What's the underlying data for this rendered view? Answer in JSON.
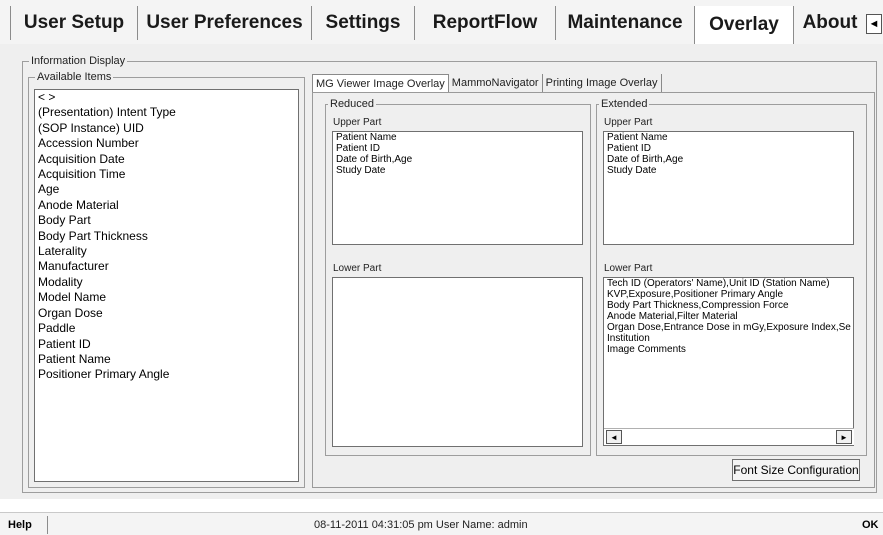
{
  "tabs": [
    "User Setup",
    "User Preferences",
    "Settings",
    "ReportFlow",
    "Maintenance",
    "Overlay",
    "About"
  ],
  "tab_scroll_icon": "◄",
  "info_display": {
    "legend": "Information Display",
    "available": {
      "legend": "Available Items",
      "items": [
        "< >",
        "(Presentation) Intent Type",
        "(SOP Instance) UID",
        "Accession Number",
        "Acquisition Date",
        "Acquisition Time",
        "Age",
        "Anode Material",
        "Body Part",
        "Body Part Thickness",
        "Laterality",
        "Manufacturer",
        "Modality",
        "Model Name",
        "Organ Dose",
        "Paddle",
        "Patient ID",
        "Patient Name",
        "Positioner Primary Angle"
      ]
    }
  },
  "subtabs": [
    "MG Viewer Image Overlay",
    "MammoNavigator",
    "Printing Image Overlay"
  ],
  "reduced": {
    "legend": "Reduced",
    "upper_label": "Upper Part",
    "upper_items": [
      "Patient Name",
      "Patient ID",
      "Date of Birth,Age",
      "Study Date"
    ],
    "lower_label": "Lower Part",
    "lower_items": []
  },
  "extended": {
    "legend": "Extended",
    "upper_label": "Upper Part",
    "upper_items": [
      "Patient Name",
      "Patient ID",
      "Date of Birth,Age",
      "Study Date"
    ],
    "lower_label": "Lower Part",
    "lower_items": [
      "Tech ID (Operators' Name),Unit ID (Station Name)",
      "KVP,Exposure,Positioner Primary Angle",
      "Body Part Thickness,Compression Force",
      "Anode Material,Filter Material",
      "Organ Dose,Entrance Dose in mGy,Exposure Index,Se",
      "Institution",
      "Image Comments"
    ]
  },
  "scroll_left_icon": "◄",
  "scroll_right_icon": "►",
  "font_size_button": "Font Size Configuration",
  "status": {
    "help": "Help",
    "text": "08-11-2011  04:31:05 pm  User Name:  admin",
    "ok": "OK"
  }
}
